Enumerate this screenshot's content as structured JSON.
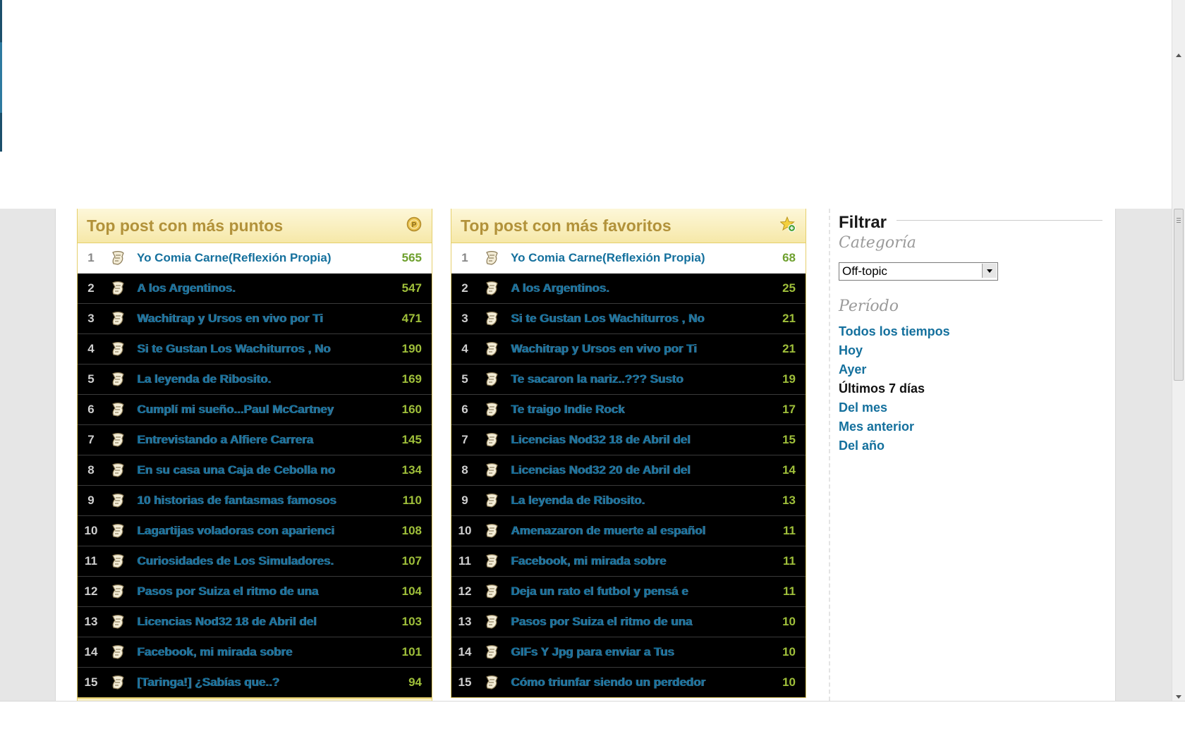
{
  "colors": {
    "link": "#14709d",
    "score": "#9fbf3a",
    "header_title": "#b2923a",
    "header_bg": "#f6e8a8"
  },
  "left_box": {
    "title": "Top post con más puntos",
    "header_icon": "points-coin-icon",
    "rows": [
      {
        "rank": "1",
        "title": "Yo Comia Carne(Reflexión Propia)",
        "score": "565"
      },
      {
        "rank": "2",
        "title": "A los Argentinos.",
        "score": "547"
      },
      {
        "rank": "3",
        "title": "Wachitrap y Ursos en vivo por Ti",
        "score": "471"
      },
      {
        "rank": "4",
        "title": "Si te Gustan Los Wachiturros , No",
        "score": "190"
      },
      {
        "rank": "5",
        "title": "La leyenda de Ribosito.",
        "score": "169"
      },
      {
        "rank": "6",
        "title": "Cumplí mi sueño...Paul McCartney",
        "score": "160"
      },
      {
        "rank": "7",
        "title": "Entrevistando a Alfiere Carrera",
        "score": "145"
      },
      {
        "rank": "8",
        "title": "En su casa una Caja de Cebolla no",
        "score": "134"
      },
      {
        "rank": "9",
        "title": "10 historias de fantasmas famosos",
        "score": "110"
      },
      {
        "rank": "10",
        "title": "Lagartijas voladoras con aparienci",
        "score": "108"
      },
      {
        "rank": "11",
        "title": "Curiosidades de Los Simuladores.",
        "score": "107"
      },
      {
        "rank": "12",
        "title": "Pasos por Suiza el ritmo de una",
        "score": "104"
      },
      {
        "rank": "13",
        "title": "Licencias Nod32 18 de Abril del",
        "score": "103"
      },
      {
        "rank": "14",
        "title": "Facebook, mi mirada sobre",
        "score": "101"
      },
      {
        "rank": "15",
        "title": "[Taringa!] ¿Sabías que..?",
        "score": "94"
      }
    ]
  },
  "mid_box": {
    "title": "Top post con más favoritos",
    "header_icon": "star-add-icon",
    "rows": [
      {
        "rank": "1",
        "title": "Yo Comia Carne(Reflexión Propia)",
        "score": "68"
      },
      {
        "rank": "2",
        "title": "A los Argentinos.",
        "score": "25"
      },
      {
        "rank": "3",
        "title": "Si te Gustan Los Wachiturros , No",
        "score": "21"
      },
      {
        "rank": "4",
        "title": "Wachitrap y Ursos en vivo por Ti",
        "score": "21"
      },
      {
        "rank": "5",
        "title": "Te sacaron la nariz..??? Susto",
        "score": "19"
      },
      {
        "rank": "6",
        "title": "Te traigo Indie Rock",
        "score": "17"
      },
      {
        "rank": "7",
        "title": "Licencias Nod32 18 de Abril del",
        "score": "15"
      },
      {
        "rank": "8",
        "title": "Licencias Nod32 20 de Abril del",
        "score": "14"
      },
      {
        "rank": "9",
        "title": "La leyenda de Ribosito.",
        "score": "13"
      },
      {
        "rank": "10",
        "title": "Amenazaron de muerte al español",
        "score": "11"
      },
      {
        "rank": "11",
        "title": "Facebook, mi mirada sobre",
        "score": "11"
      },
      {
        "rank": "12",
        "title": "Deja un rato el futbol y pensá e",
        "score": "11"
      },
      {
        "rank": "13",
        "title": "Pasos por Suiza el ritmo de una",
        "score": "10"
      },
      {
        "rank": "14",
        "title": "GIFs Y Jpg para enviar a Tus",
        "score": "10"
      },
      {
        "rank": "15",
        "title": "Cómo triunfar siendo un perdedor",
        "score": "10"
      }
    ]
  },
  "filter": {
    "title": "Filtrar",
    "category_label": "Categoría",
    "category_selected": "Off-topic",
    "period_label": "Período",
    "periods": [
      {
        "label": "Todos los tiempos",
        "active": false
      },
      {
        "label": "Hoy",
        "active": false
      },
      {
        "label": "Ayer",
        "active": false
      },
      {
        "label": "Últimos 7 días",
        "active": true
      },
      {
        "label": "Del mes",
        "active": false
      },
      {
        "label": "Mes anterior",
        "active": false
      },
      {
        "label": "Del año",
        "active": false
      }
    ]
  }
}
